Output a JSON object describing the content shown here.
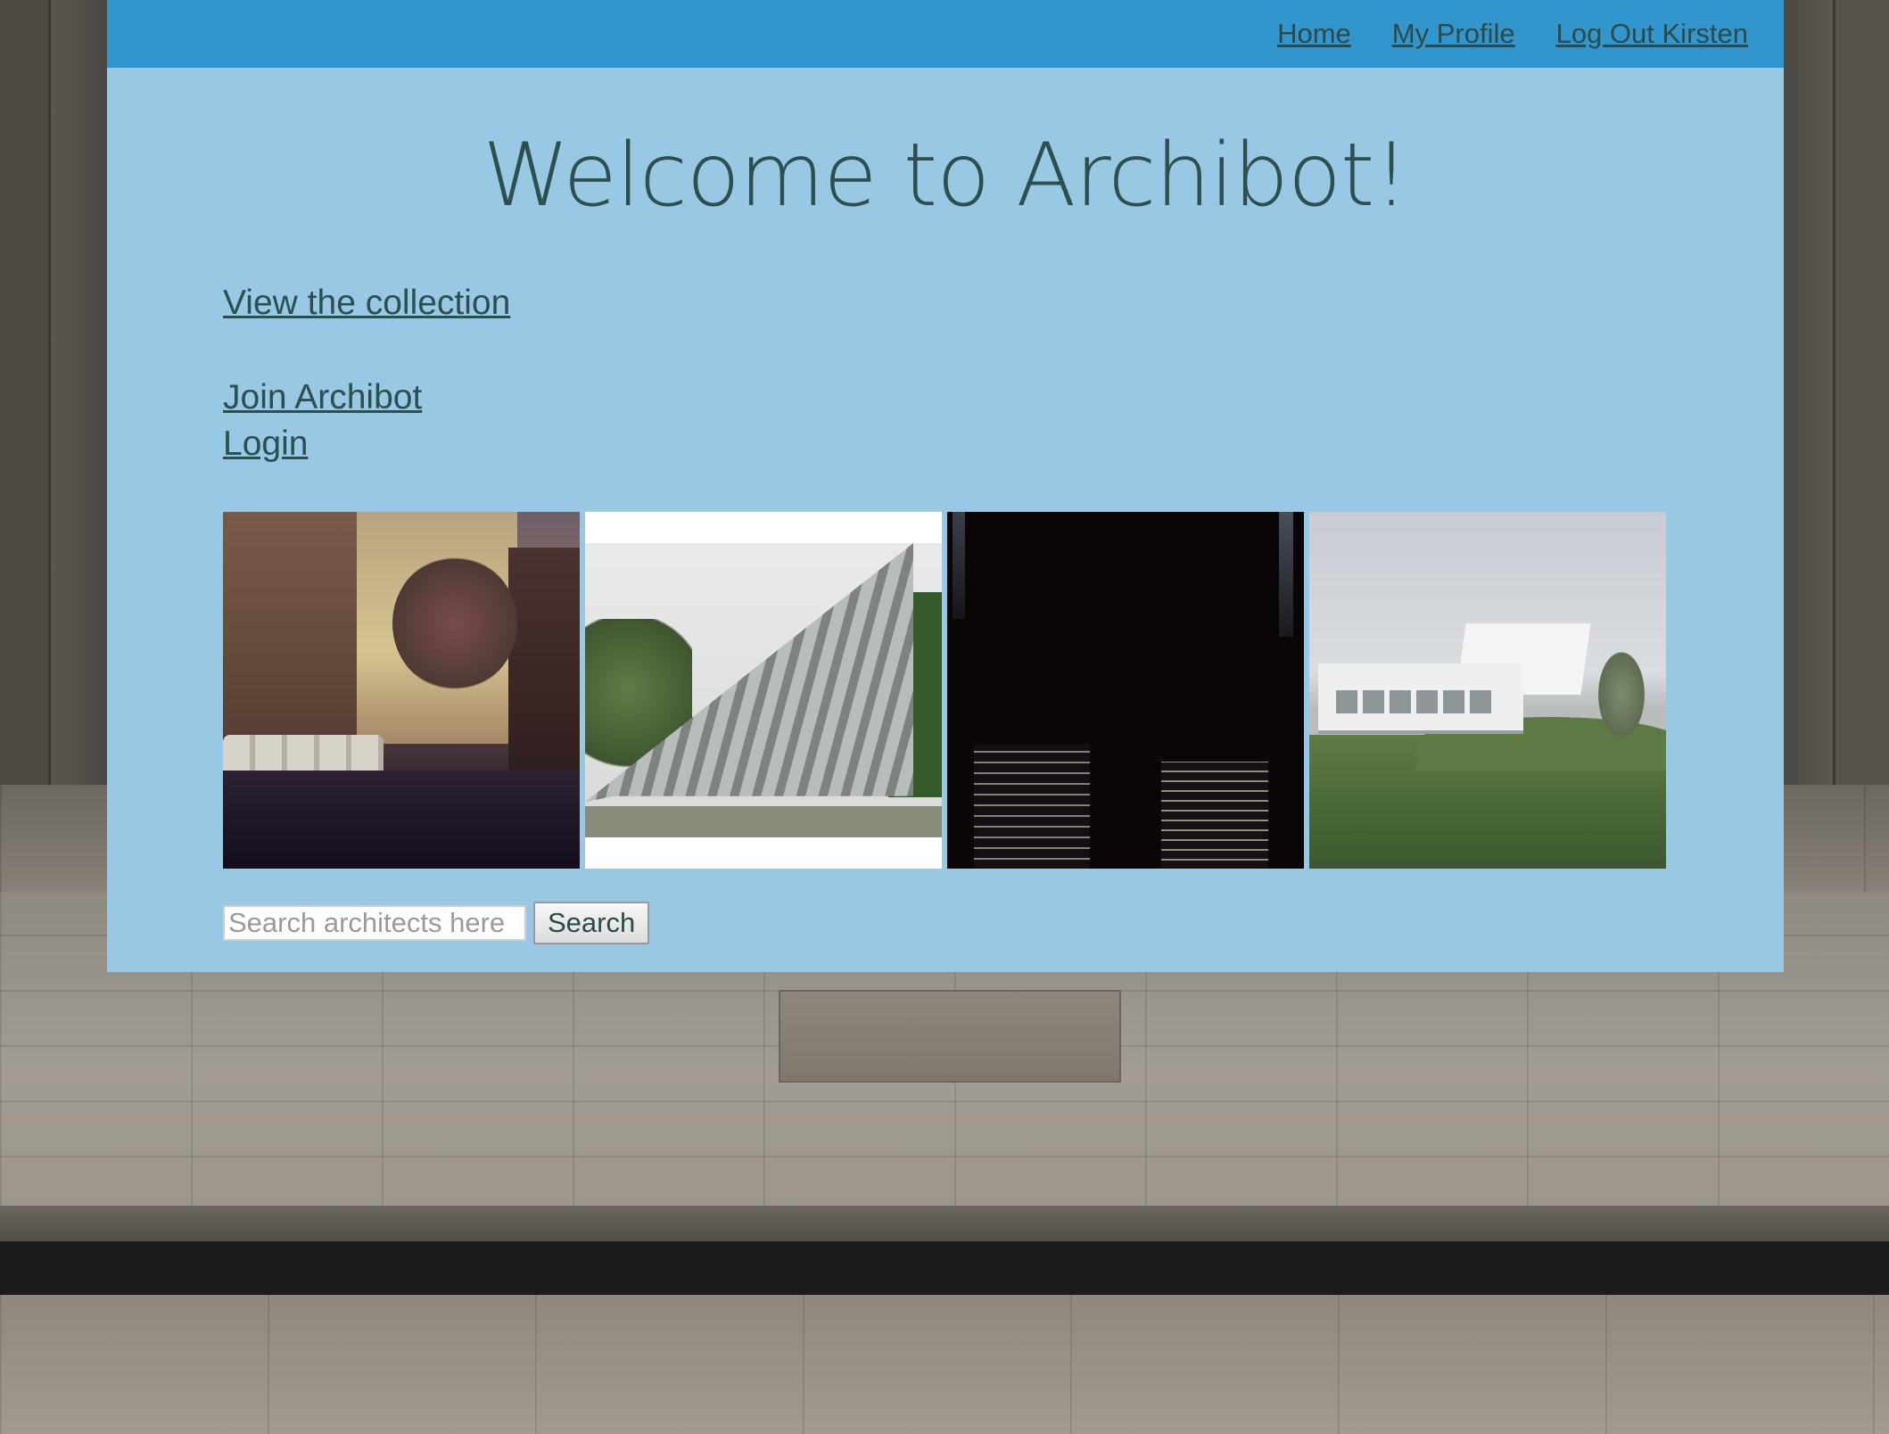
{
  "nav": {
    "home": "Home",
    "profile": "My Profile",
    "logout": "Log Out Kirsten"
  },
  "main": {
    "title": "Welcome to Archibot!",
    "view_collection": "View the collection",
    "join": "Join Archibot",
    "login": "Login"
  },
  "gallery": {
    "photos": [
      "architecture-photo-1",
      "architecture-photo-2",
      "architecture-photo-3",
      "architecture-photo-4"
    ]
  },
  "search": {
    "placeholder": "Search architects here",
    "value": "",
    "button_label": "Search"
  },
  "colors": {
    "navbar": "#3295cb",
    "panel": "#98c8e3",
    "text": "#2c4f4f"
  }
}
